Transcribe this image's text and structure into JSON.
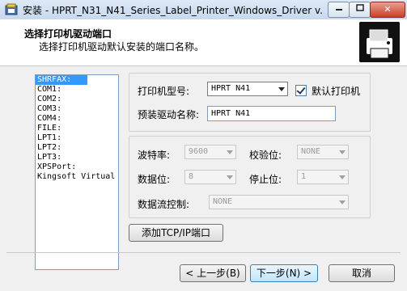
{
  "window": {
    "title": "安装 - HPRT_N31_N41_Series_Label_Printer_Windows_Driver v...",
    "close": "✕"
  },
  "header": {
    "title": "选择打印机驱动端口",
    "subtitle": "选择打印机驱动默认安装的端口名称。"
  },
  "ports": [
    "SHRFAX:",
    "COM1:",
    "COM2:",
    "COM3:",
    "COM4:",
    "FILE:",
    "LPT1:",
    "LPT2:",
    "LPT3:",
    "XPSPort:",
    "Kingsoft Virtual"
  ],
  "selected_port": "SHRFAX:",
  "printer": {
    "model_label": "打印机型号:",
    "model_value": "HPRT N41",
    "default_label": "默认打印机",
    "default_checked": true,
    "preset_label": "预装驱动名称:",
    "preset_value": "HPRT N41"
  },
  "serial": {
    "baud_label": "波特率:",
    "baud_value": "9600",
    "parity_label": "校验位:",
    "parity_value": "NONE",
    "databits_label": "数据位:",
    "databits_value": "8",
    "stopbits_label": "停止位:",
    "stopbits_value": "1",
    "flow_label": "数据流控制:",
    "flow_value": "NONE"
  },
  "buttons": {
    "add_tcp": "添加TCP/IP端口",
    "back": "< 上一步(B)",
    "next": "下一步(N) >",
    "cancel": "取消"
  }
}
